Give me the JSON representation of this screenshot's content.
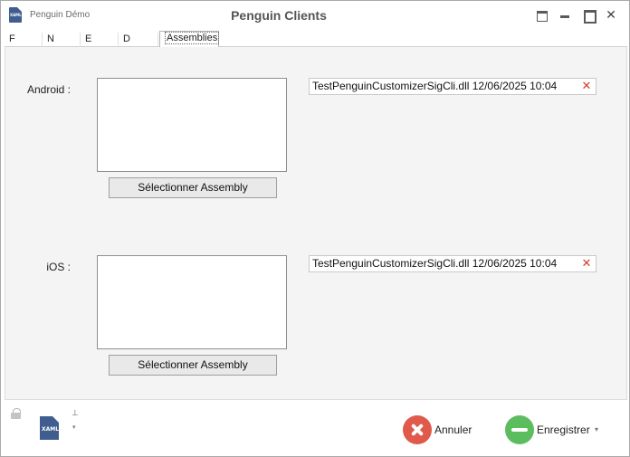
{
  "titlebar": {
    "app_name": "Penguin Démo",
    "title": "Penguin Clients",
    "app_icon_text": "XAML",
    "close_glyph": "✕"
  },
  "tabs": [
    {
      "label": "F"
    },
    {
      "label": "N"
    },
    {
      "label": "E"
    },
    {
      "label": "D"
    },
    {
      "label": "Assemblies",
      "active": true
    }
  ],
  "assemblies": {
    "android": {
      "label": "Android :",
      "select_button": "Sélectionner Assembly",
      "file_value": "TestPenguinCustomizerSigCli.dll 12/06/2025 10:04",
      "clear_glyph": "✕"
    },
    "ios": {
      "label": "iOS :",
      "select_button": "Sélectionner Assembly",
      "file_value": "TestPenguinCustomizerSigCli.dll 12/06/2025 10:04",
      "clear_glyph": "✕"
    }
  },
  "footer": {
    "xaml_icon_text": "XAML",
    "pin_glyph": "⊥",
    "caret_glyph": "▾",
    "cancel_label": "Annuler",
    "save_label": "Enregistrer"
  },
  "colors": {
    "cancel": "#e0594b",
    "save": "#5cbd5f",
    "clear": "#d23b2f",
    "xaml_icon": "#3f5e8f"
  }
}
